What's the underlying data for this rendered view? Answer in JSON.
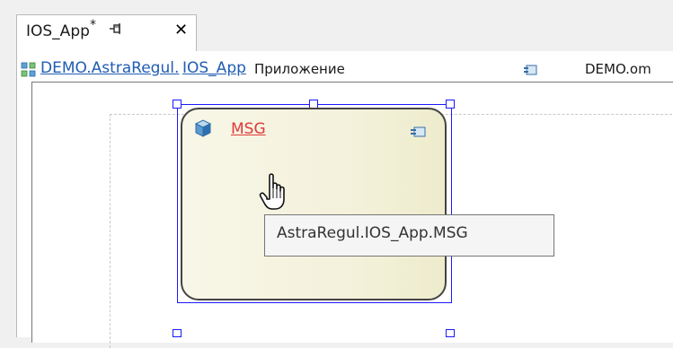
{
  "tab": {
    "title": "IOS_App",
    "dirty_mark": "*",
    "pin_glyph": "⊣⊢",
    "close_glyph": "✕"
  },
  "breadcrumb": {
    "icon": "diagram-grid-icon",
    "root": "DEMO.AstraRegul.",
    "current": "IOS_App",
    "type_label": "Приложение",
    "component_icon": "component-icon",
    "extra": "DEMO.om"
  },
  "diagram": {
    "app_node": {
      "name": "MSG",
      "icon": "cube-icon",
      "component_icon": "component-icon"
    },
    "tooltip": "AstraRegul.IOS_App.MSG",
    "cursor": "hand-pointer-icon"
  },
  "colors": {
    "link": "#1f5db3",
    "node_name": "#e03a3a",
    "selection": "#1a1aff",
    "node_fill": "#f4f2dc"
  }
}
